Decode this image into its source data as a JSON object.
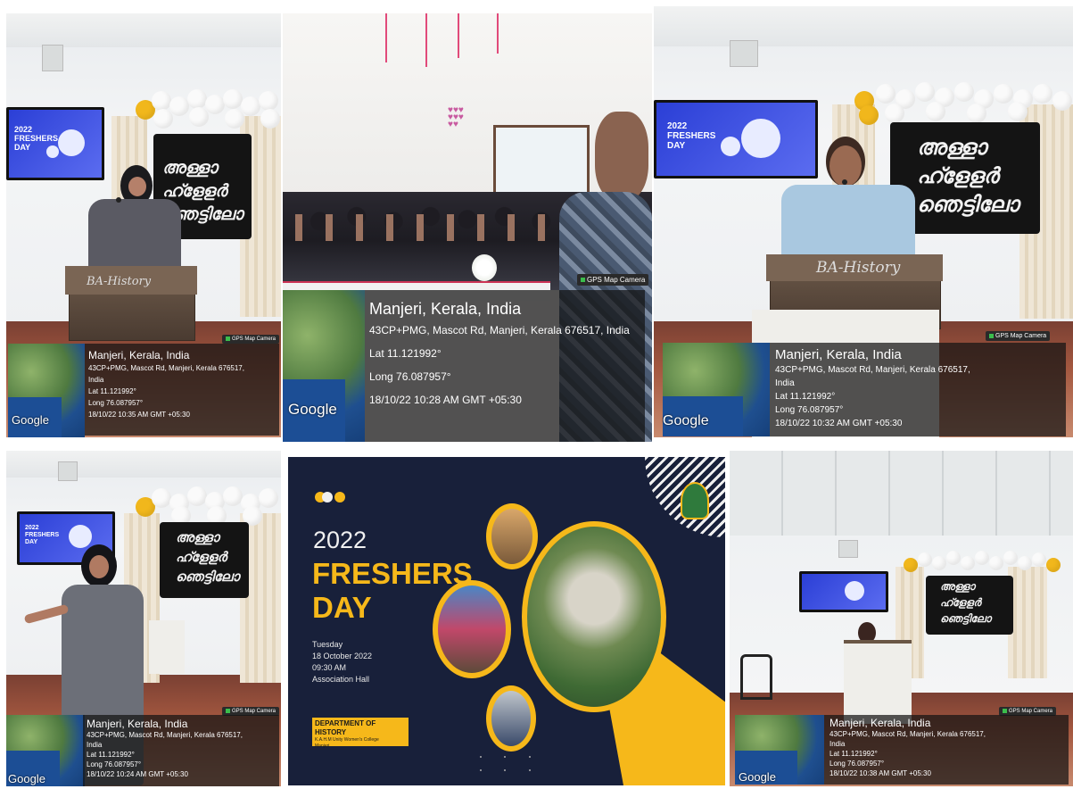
{
  "photos": [
    {
      "gps_chip": "GPS Map Camera",
      "city": "Manjeri, Kerala, India",
      "address_lines": [
        "43CP+PMG, Mascot Rd, Manjeri, Kerala 676517,",
        "India"
      ],
      "lat": "Lat 11.121992°",
      "long": "Long 76.087957°",
      "datetime": "18/10/22 10:35 AM GMT +05:30",
      "google": "Google",
      "podium_text": "BA-History"
    },
    {
      "gps_chip": "GPS Map Camera",
      "city": "Manjeri, Kerala, India",
      "address_lines": [
        "43CP+PMG, Mascot Rd, Manjeri, Kerala 676517, India"
      ],
      "lat": "Lat 11.121992°",
      "long": "Long 76.087957°",
      "datetime": "18/10/22 10:28 AM GMT +05:30",
      "google": "Google"
    },
    {
      "gps_chip": "GPS Map Camera",
      "city": "Manjeri, Kerala, India",
      "address_lines": [
        "43CP+PMG, Mascot Rd, Manjeri, Kerala 676517,",
        "India"
      ],
      "lat": "Lat 11.121992°",
      "long": "Long 76.087957°",
      "datetime": "18/10/22 10:32 AM GMT +05:30",
      "google": "Google",
      "podium_text": "BA-History"
    },
    {
      "gps_chip": "GPS Map Camera",
      "city": "Manjeri, Kerala, India",
      "address_lines": [
        "43CP+PMG, Mascot Rd, Manjeri, Kerala 676517,",
        "India"
      ],
      "lat": "Lat 11.121992°",
      "long": "Long 76.087957°",
      "datetime": "18/10/22 10:24 AM GMT +05:30",
      "google": "Google"
    },
    {
      "gps_chip": "GPS Map Camera",
      "city": "Manjeri, Kerala, India",
      "address_lines": [
        "43CP+PMG, Mascot Rd, Manjeri, Kerala 676517,",
        "India"
      ],
      "lat": "Lat 11.121992°",
      "long": "Long 76.087957°",
      "datetime": "18/10/22 10:38 AM GMT +05:30",
      "google": "Google"
    }
  ],
  "banner_text": "അള്ളാ ഹ്ളേളർ ഞെട്ടിലോ",
  "screen_text": [
    "2022",
    "FRESHERS",
    "DAY"
  ],
  "poster": {
    "year": "2022",
    "title_1": "FRESHERS",
    "title_2": "DAY",
    "day": "Tuesday",
    "date": "18 October 2022",
    "time": "09:30 AM",
    "venue": "Association Hall",
    "dept_title": "DEPARTMENT OF HISTORY",
    "college": "K.A.H.M Unity Women's College",
    "place": "Manjeri",
    "colors": {
      "background": "#18203a",
      "accent": "#f6b81a"
    }
  }
}
